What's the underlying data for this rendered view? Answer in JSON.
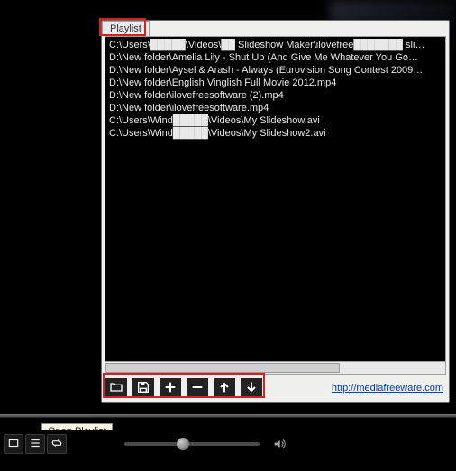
{
  "playlist": {
    "title": "Playlist",
    "items": [
      {
        "path_visible": "C:\\Users\\█████\\Videos\\██ Slideshow Maker\\ilovefree███████ sli…"
      },
      {
        "path_visible": "D:\\New folder\\Amelia Lily - Shut Up (And Give Me Whatever You Go…"
      },
      {
        "path_visible": "D:\\New folder\\Aysel & Arash - Always (Eurovision Song Contest 2009…"
      },
      {
        "path_visible": "D:\\New folder\\English Vinglish Full Movie 2012.mp4"
      },
      {
        "path_visible": "D:\\New folder\\ilovefreesoftware (2).mp4"
      },
      {
        "path_visible": "D:\\New folder\\ilovefreesoftware.mp4"
      },
      {
        "path_visible": "C:\\Users\\Wind█████\\Videos\\My Slideshow.avi"
      },
      {
        "path_visible": "C:\\Users\\Wind█████\\Videos\\My Slideshow2.avi"
      }
    ],
    "link_text": "http://mediafreeware.com",
    "link_href": "http://mediafreeware.com"
  },
  "tooltip": {
    "text": "Open Playlist"
  },
  "icons": {
    "open": "open-folder-icon",
    "save": "save-floppy-icon",
    "add": "plus-icon",
    "remove": "minus-icon",
    "up": "arrow-up-icon",
    "down": "arrow-down-icon",
    "fullscreen": "fullscreen-icon",
    "playlist": "playlist-icon",
    "repeat": "repeat-icon",
    "volume": "volume-icon"
  }
}
